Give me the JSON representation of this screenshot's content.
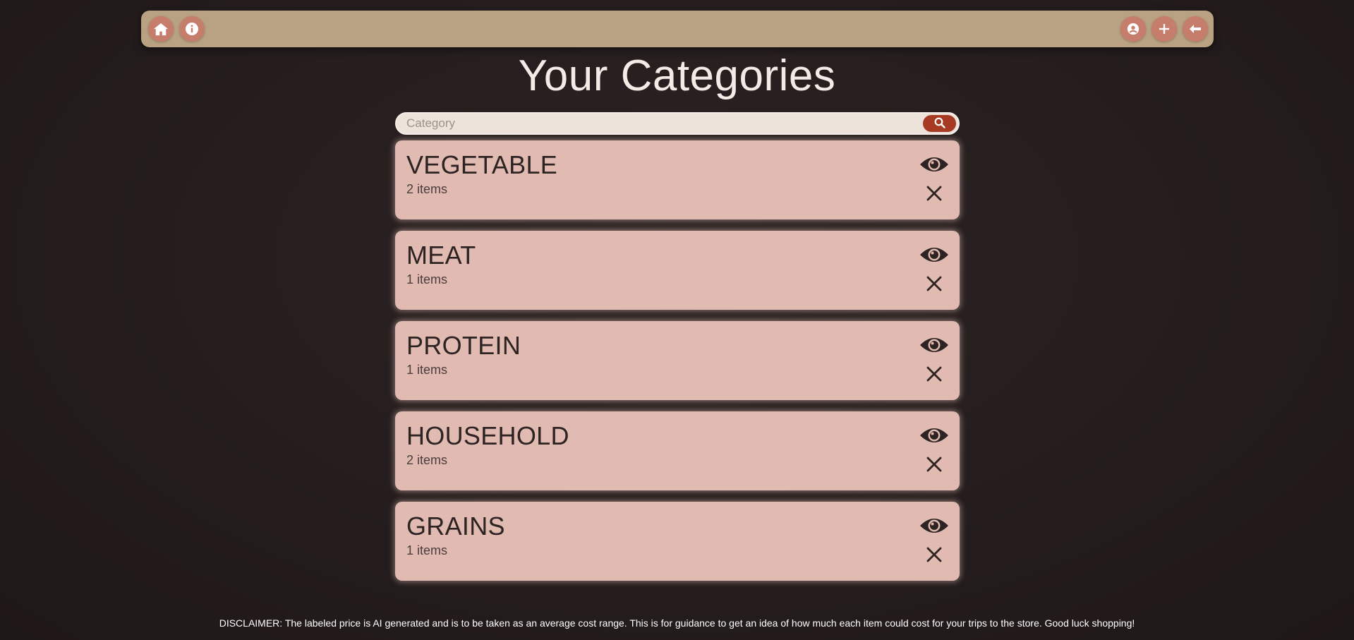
{
  "navbar": {
    "left_buttons": [
      {
        "icon": "home-icon"
      },
      {
        "icon": "info-icon"
      }
    ],
    "right_buttons": [
      {
        "icon": "user-icon"
      },
      {
        "icon": "plus-icon"
      },
      {
        "icon": "arrow-left-icon"
      }
    ]
  },
  "page": {
    "title": "Your Categories"
  },
  "search": {
    "placeholder": "Category",
    "value": ""
  },
  "categories": [
    {
      "name": "VEGETABLE",
      "count": "2 items"
    },
    {
      "name": "MEAT",
      "count": "1 items"
    },
    {
      "name": "PROTEIN",
      "count": "1 items"
    },
    {
      "name": "HOUSEHOLD",
      "count": "2 items"
    },
    {
      "name": "GRAINS",
      "count": "1 items"
    }
  ],
  "footer": {
    "disclaimer": "DISCLAIMER: The labeled price is AI generated and is to be taken as an average cost range. This is for guidance to get an idea of how much each item could cost for your trips to the store. Good luck shopping!"
  },
  "colors": {
    "navbar": "#b8a282",
    "nav_button": "#c77d6c",
    "search_button": "#a63a22",
    "card": "#e1bbb2",
    "background": "#251d1d"
  }
}
